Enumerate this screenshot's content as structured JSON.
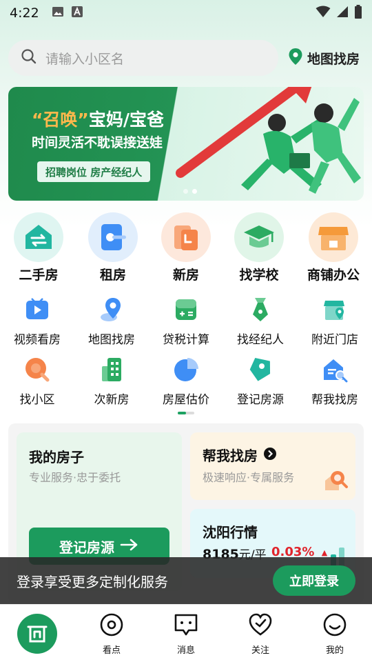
{
  "status_bar": {
    "time": "4:22"
  },
  "search": {
    "placeholder": "请输入小区名",
    "map_find_label": "地图找房"
  },
  "banner": {
    "title_accent": "“召唤”",
    "title_rest": "宝妈/宝爸",
    "subtitle": "时间灵活不耽误接送娃",
    "tag": "招聘岗位 房产经纪人",
    "page_count": 2,
    "active_page": 2
  },
  "main_services": [
    {
      "label": "二手房",
      "icon": "house-exchange-icon",
      "color": "#22b6a0",
      "bg": "#dff5f1"
    },
    {
      "label": "租房",
      "icon": "key-icon",
      "color": "#3f8ef5",
      "bg": "#e1eefc"
    },
    {
      "label": "新房",
      "icon": "clock-building-icon",
      "color": "#f5844a",
      "bg": "#fde8dc"
    },
    {
      "label": "找学校",
      "icon": "graduation-cap-icon",
      "color": "#2cab62",
      "bg": "#e0f5e8"
    },
    {
      "label": "商铺办公",
      "icon": "storefront-icon",
      "color": "#f59a3a",
      "bg": "#fde9d6"
    }
  ],
  "tools_row1": [
    {
      "label": "视频看房",
      "icon": "video-play-icon",
      "color": "#3f8ef5"
    },
    {
      "label": "地图找房",
      "icon": "map-pin-icon",
      "color": "#3f8ef5"
    },
    {
      "label": "贷税计算",
      "icon": "calculator-icon",
      "color": "#2cab62"
    },
    {
      "label": "找经纪人",
      "icon": "agent-tie-icon",
      "color": "#2cab62"
    },
    {
      "label": "附近门店",
      "icon": "nearby-store-icon",
      "color": "#22b6a0"
    }
  ],
  "tools_row2": [
    {
      "label": "找小区",
      "icon": "search-community-icon",
      "color": "#f5844a"
    },
    {
      "label": "次新房",
      "icon": "apartment-building-icon",
      "color": "#2cab62"
    },
    {
      "label": "房屋估价",
      "icon": "pie-chart-icon",
      "color": "#3f8ef5"
    },
    {
      "label": "登记房源",
      "icon": "register-tag-icon",
      "color": "#22b6a0"
    },
    {
      "label": "帮我找房",
      "icon": "house-search-icon",
      "color": "#3f8ef5"
    }
  ],
  "cards": {
    "mine": {
      "title": "我的房子",
      "subtitle": "专业服务·忠于委托",
      "button": "登记房源"
    },
    "help": {
      "title": "帮我找房",
      "subtitle": "极速响应·专属服务"
    },
    "market": {
      "title": "沈阳行情",
      "price": "8185",
      "unit": "元/平",
      "change": "0.03%"
    }
  },
  "login_toast": {
    "text": "登录享受更多定制化服务",
    "button": "立即登录"
  },
  "tab_bar": [
    {
      "label": "",
      "icon": "home-icon"
    },
    {
      "label": "看点",
      "icon": "eye-target-icon"
    },
    {
      "label": "消息",
      "icon": "message-bubble-icon"
    },
    {
      "label": "关注",
      "icon": "heart-check-icon"
    },
    {
      "label": "我的",
      "icon": "smile-face-icon"
    }
  ],
  "colors": {
    "brand": "#1c9b5d",
    "up": "#e0242c"
  }
}
